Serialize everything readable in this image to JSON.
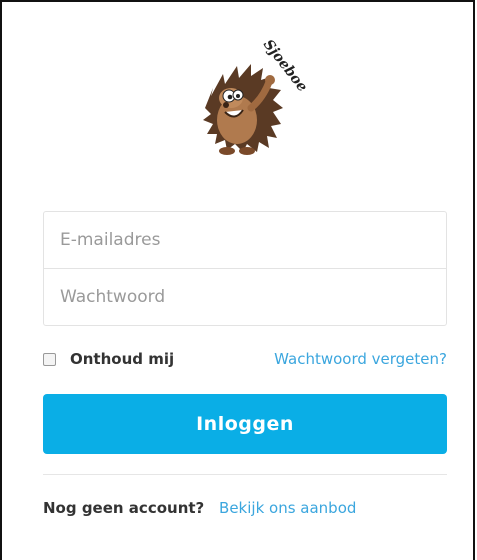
{
  "logo": {
    "text": "Sjoeboe",
    "icon": "hedgehog-mascot"
  },
  "form": {
    "email_placeholder": "E-mailadres",
    "password_placeholder": "Wachtwoord",
    "remember_label": "Onthoud mij",
    "remember_checked": false,
    "forgot_link": "Wachtwoord vergeten?",
    "login_button": "Inloggen"
  },
  "footer": {
    "question": "Nog geen account?",
    "offer_link": "Bekijk ons aanbod"
  },
  "colors": {
    "accent": "#0aaee6",
    "link": "#3ba6de"
  }
}
